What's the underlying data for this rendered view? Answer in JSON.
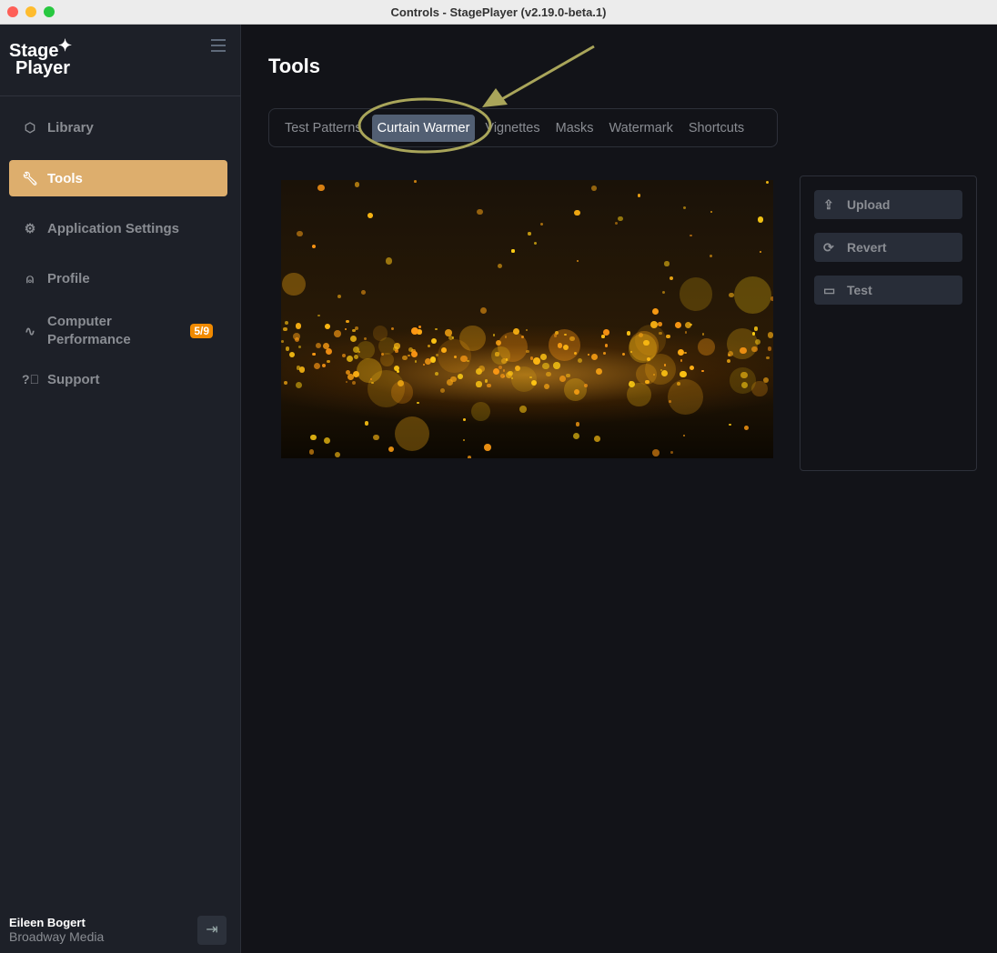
{
  "window": {
    "title": "Controls - StagePlayer (v2.19.0-beta.1)"
  },
  "sidebar": {
    "logo": {
      "line1": "Stage",
      "line2": "Player"
    },
    "items": [
      {
        "label": "Library",
        "icon": "cube-icon"
      },
      {
        "label": "Tools",
        "icon": "wrench-icon",
        "active": true
      },
      {
        "label": "Application Settings",
        "icon": "gear-icon"
      },
      {
        "label": "Profile",
        "icon": "user-icon"
      },
      {
        "label_line1": "Computer",
        "label_line2": "Performance",
        "icon": "activity-icon",
        "badge": "5/9"
      },
      {
        "label": "Support",
        "icon": "help-icon"
      }
    ],
    "user": {
      "name": "Eileen Bogert",
      "org": "Broadway Media"
    }
  },
  "main": {
    "title": "Tools",
    "tabs": [
      "Test Patterns",
      "Curtain Warmer",
      "Vignettes",
      "Masks",
      "Watermark",
      "Shortcuts"
    ],
    "active_tab": "Curtain Warmer",
    "buttons": {
      "upload": "Upload",
      "revert": "Revert",
      "test": "Test"
    }
  },
  "colors": {
    "accent": "#ddae6d",
    "badge": "#f08a00",
    "annotation": "#a9a55a"
  }
}
